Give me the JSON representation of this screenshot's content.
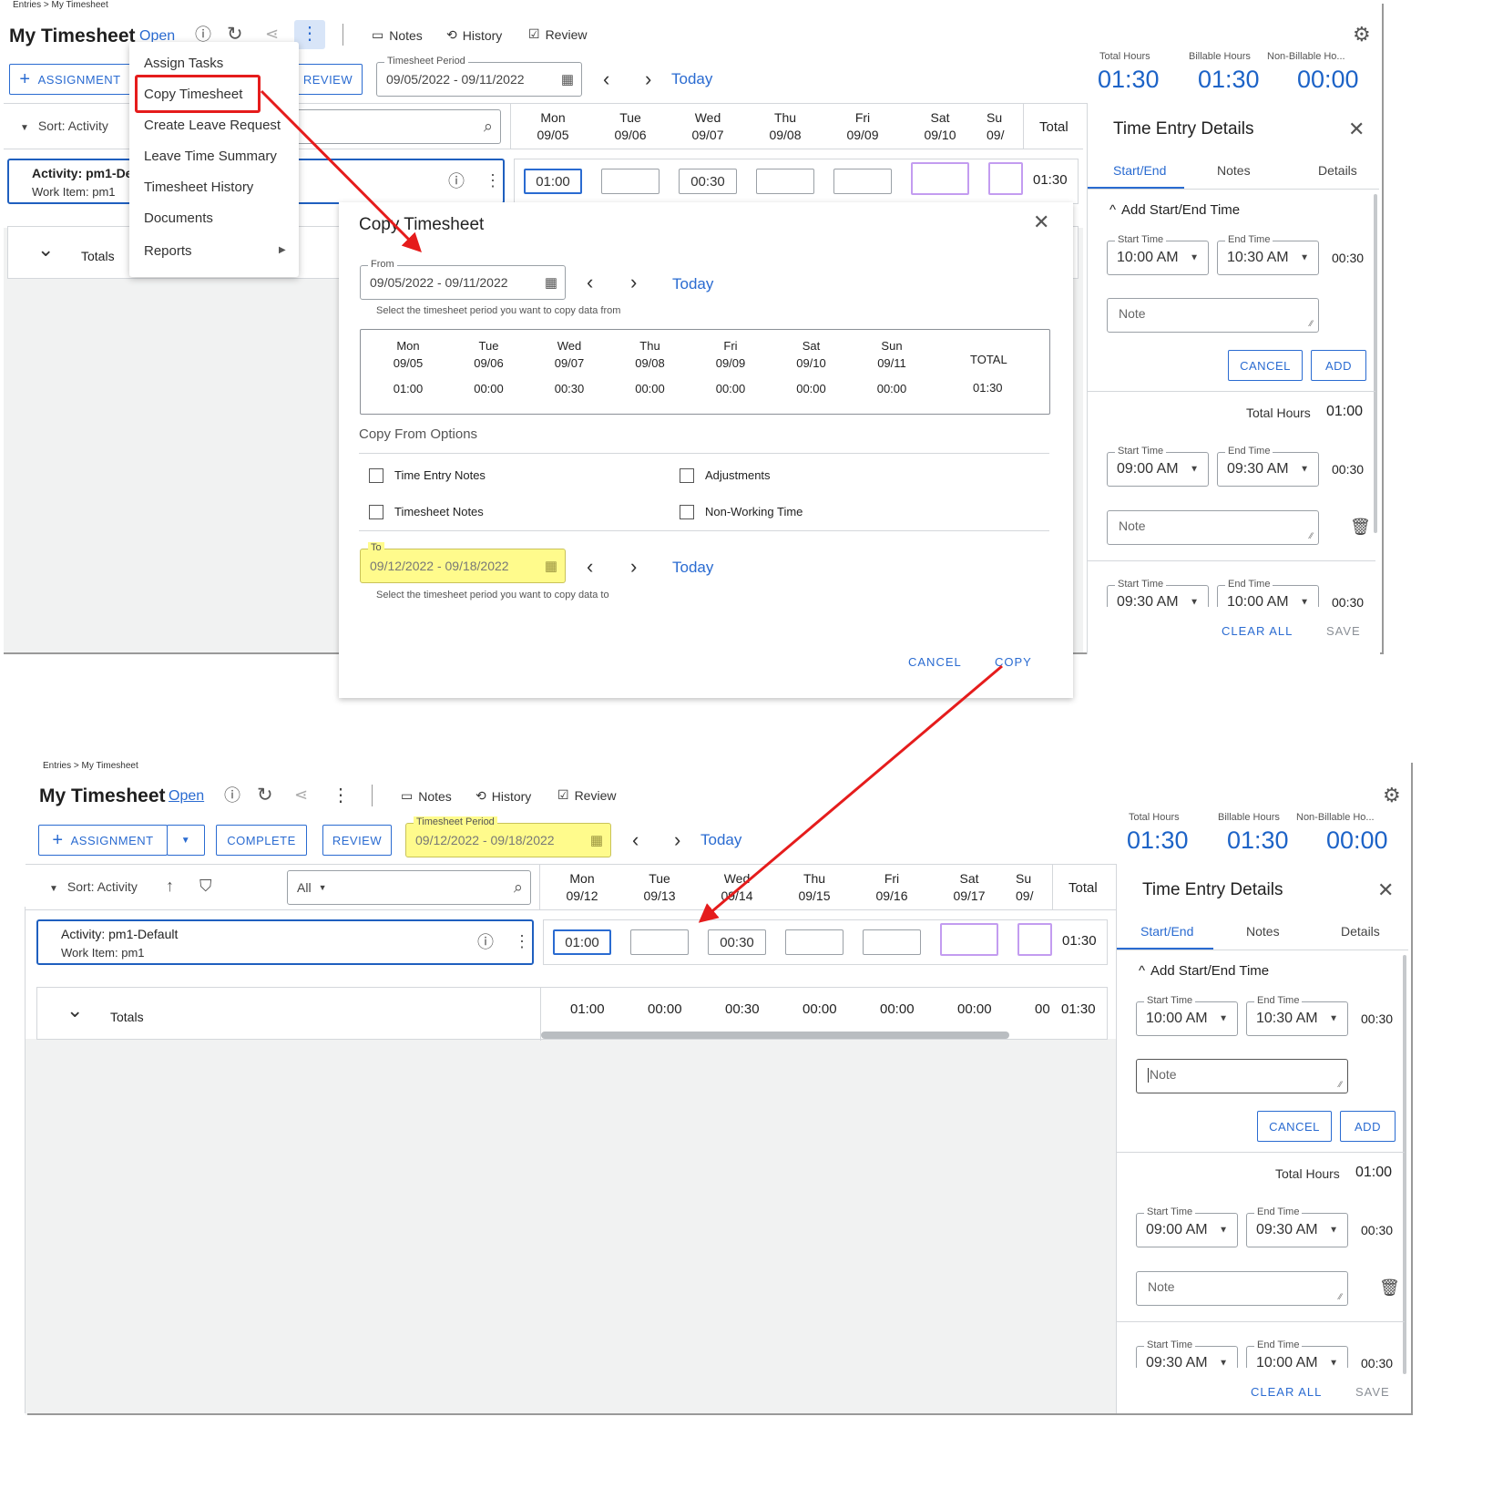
{
  "breadcrumb": "Entries > My Timesheet",
  "page_title": "My Timesheet",
  "status": "Open",
  "toolbar": {
    "notes": "Notes",
    "history": "History",
    "review": "Review"
  },
  "buttons": {
    "assignment": "ASSIGNMENT",
    "complete": "COMPLETE",
    "review": "REVIEW"
  },
  "period_label": "Timesheet Period",
  "today": "Today",
  "kpi": {
    "total_label": "Total Hours",
    "total_value": "01:30",
    "billable_label": "Billable Hours",
    "billable_value": "01:30",
    "nonbillable_label": "Non-Billable Ho...",
    "nonbillable_value": "00:00"
  },
  "sort_label": "Sort: Activity",
  "filter_all": "All",
  "total_header": "Total",
  "activity": {
    "name": "Activity: pm1-Default",
    "name_truncated": "Activity: pm1-De",
    "work_item": "Work Item: pm1"
  },
  "totals_label": "Totals",
  "top": {
    "period": "09/05/2022 - 09/11/2022",
    "days": [
      {
        "day": "Mon",
        "date": "09/05"
      },
      {
        "day": "Tue",
        "date": "09/06"
      },
      {
        "day": "Wed",
        "date": "09/07"
      },
      {
        "day": "Thu",
        "date": "09/08"
      },
      {
        "day": "Fri",
        "date": "09/09"
      },
      {
        "day": "Sat",
        "date": "09/10"
      },
      {
        "day": "Su",
        "date": "09/"
      }
    ],
    "cells": [
      "01:00",
      "",
      "00:30",
      "",
      "",
      "",
      ""
    ],
    "row_total": "01:30"
  },
  "bottom": {
    "period": "09/12/2022 - 09/18/2022",
    "days": [
      {
        "day": "Mon",
        "date": "09/12"
      },
      {
        "day": "Tue",
        "date": "09/13"
      },
      {
        "day": "Wed",
        "date": "09/14"
      },
      {
        "day": "Thu",
        "date": "09/15"
      },
      {
        "day": "Fri",
        "date": "09/16"
      },
      {
        "day": "Sat",
        "date": "09/17"
      },
      {
        "day": "Su",
        "date": "09/"
      }
    ],
    "cells": [
      "01:00",
      "",
      "00:30",
      "",
      "",
      "",
      ""
    ],
    "row_total": "01:30",
    "totals": [
      "01:00",
      "00:00",
      "00:30",
      "00:00",
      "00:00",
      "00:00",
      "00"
    ],
    "totals_total": "01:30"
  },
  "menu": {
    "items": [
      "Assign Tasks",
      "Copy Timesheet",
      "Create Leave Request",
      "Leave Time Summary",
      "Timesheet History",
      "Documents",
      "Reports"
    ]
  },
  "dialog": {
    "title": "Copy Timesheet",
    "from_label": "From",
    "from_value": "09/05/2022 - 09/11/2022",
    "from_hint": "Select the timesheet period you want to copy data from",
    "days": [
      {
        "day": "Mon",
        "date": "09/05",
        "val": "01:00"
      },
      {
        "day": "Tue",
        "date": "09/06",
        "val": "00:00"
      },
      {
        "day": "Wed",
        "date": "09/07",
        "val": "00:30"
      },
      {
        "day": "Thu",
        "date": "09/08",
        "val": "00:00"
      },
      {
        "day": "Fri",
        "date": "09/09",
        "val": "00:00"
      },
      {
        "day": "Sat",
        "date": "09/10",
        "val": "00:00"
      },
      {
        "day": "Sun",
        "date": "09/11",
        "val": "00:00"
      }
    ],
    "total_label": "TOTAL",
    "total_value": "01:30",
    "options_title": "Copy From Options",
    "options": [
      "Time Entry Notes",
      "Adjustments",
      "Timesheet Notes",
      "Non-Working Time"
    ],
    "to_label": "To",
    "to_value": "09/12/2022 - 09/18/2022",
    "to_hint": "Select the timesheet period you want to copy data to",
    "cancel": "CANCEL",
    "copy": "COPY"
  },
  "details": {
    "title": "Time Entry Details",
    "tabs": [
      "Start/End",
      "Notes",
      "Details"
    ],
    "add_title": "Add Start/End Time",
    "start_label": "Start Time",
    "end_label": "End Time",
    "note_placeholder": "Note",
    "cancel": "CANCEL",
    "add": "ADD",
    "total_hours_label": "Total Hours",
    "total_hours_value": "01:00",
    "new_entry": {
      "start": "10:00 AM",
      "end": "10:30 AM",
      "dur": "00:30"
    },
    "entries": [
      {
        "start": "09:00 AM",
        "end": "09:30 AM",
        "dur": "00:30"
      },
      {
        "start": "09:30 AM",
        "end": "10:00 AM",
        "dur": "00:30"
      }
    ],
    "clear_all": "CLEAR ALL",
    "save": "SAVE"
  },
  "colors": {
    "accent": "#2a6bd1",
    "highlight": "#fffb8c",
    "arrow": "#e51c1c",
    "purple": "#c39cf0"
  }
}
